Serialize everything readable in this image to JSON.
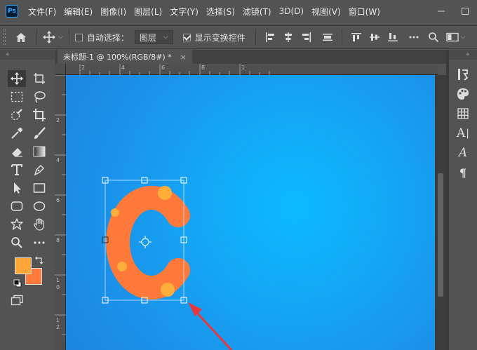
{
  "app": {
    "logo_text": "Ps"
  },
  "menu": [
    "文件(F)",
    "编辑(E)",
    "图像(I)",
    "图层(L)",
    "文字(Y)",
    "选择(S)",
    "滤镜(T)",
    "3D(D)",
    "视图(V)",
    "窗口(W)"
  ],
  "options_bar": {
    "auto_select_label": "自动选择：",
    "auto_select_checked": false,
    "layer_select_value": "图层",
    "show_transform_label": "显示变换控件",
    "show_transform_checked": true
  },
  "document": {
    "tab_title": "未标题-1 @ 100%(RGB/8#) *",
    "close_glyph": "×"
  },
  "rulers": {
    "horizontal_labels": [
      "2",
      "4",
      "6",
      "8",
      "1"
    ],
    "vertical_labels": [
      "2",
      "4",
      "6",
      "8",
      "1",
      "0",
      "1",
      "2"
    ]
  },
  "colors": {
    "foreground": "#ffa63a",
    "background": "#ff7a3a",
    "letter_fill": "#ff7a3a",
    "letter_dots": "#ffae3c",
    "arrow": "#e8383d"
  },
  "right_panel": {
    "char_label": "A",
    "para_label": "¶"
  }
}
